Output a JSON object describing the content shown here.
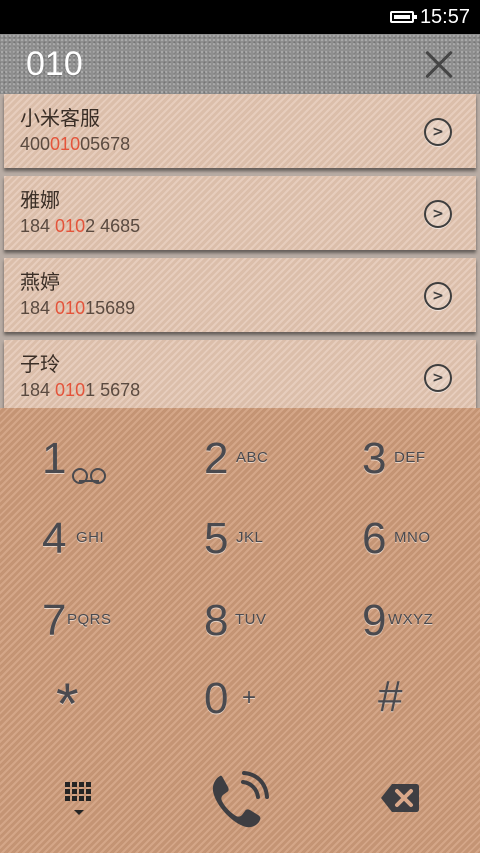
{
  "status_bar": {
    "time": "15:57",
    "battery_icon": "battery-full-icon"
  },
  "header": {
    "dialed_number": "010",
    "clear_icon": "close-icon",
    "text_color": "#ffffff"
  },
  "results": [
    {
      "name": "小米客服",
      "number_prefix": "400",
      "number_match": "010",
      "number_suffix": "05678"
    },
    {
      "name": "雅娜",
      "number_prefix": "184 ",
      "number_match": "010",
      "number_suffix": "2 4685"
    },
    {
      "name": "燕婷",
      "number_prefix": "184 ",
      "number_match": "010",
      "number_suffix": "15689"
    },
    {
      "name": "子玲",
      "number_prefix": "184 ",
      "number_match": "010",
      "number_suffix": "1 5678"
    }
  ],
  "dialpad": {
    "keys": [
      {
        "digit": "1",
        "letters": "",
        "icon": "voicemail-icon"
      },
      {
        "digit": "2",
        "letters": "ABC"
      },
      {
        "digit": "3",
        "letters": "DEF"
      },
      {
        "digit": "4",
        "letters": "GHI"
      },
      {
        "digit": "5",
        "letters": "JKL"
      },
      {
        "digit": "6",
        "letters": "MNO"
      },
      {
        "digit": "7",
        "letters": "PQRS"
      },
      {
        "digit": "8",
        "letters": "TUV"
      },
      {
        "digit": "9",
        "letters": "WXYZ"
      },
      {
        "digit": "*",
        "letters": ""
      },
      {
        "digit": "0",
        "letters": "+"
      },
      {
        "digit": "#",
        "letters": ""
      }
    ],
    "bottom": {
      "left_icon": "dialpad-toggle-icon",
      "center_icon": "call-icon",
      "right_icon": "backspace-icon"
    }
  },
  "colors": {
    "highlight": "#e4543b",
    "dialpad_bg": "#cf9c7a",
    "result_bg": "#e2c4b0",
    "key_text": "#4a4a4f"
  }
}
